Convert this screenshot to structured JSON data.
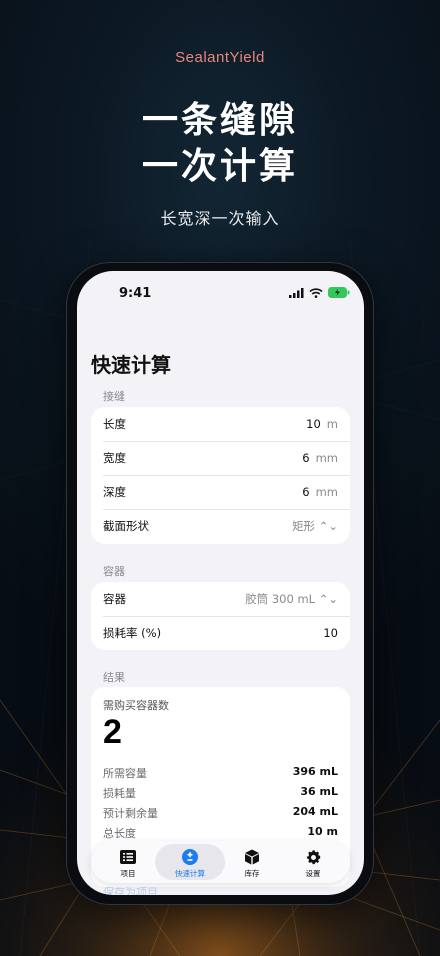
{
  "brand": "SealantYield",
  "headline_line1": "一条缝隙",
  "headline_line2": "一次计算",
  "tagline": "长宽深一次输入",
  "status_bar": {
    "time": "9:41"
  },
  "page_title": "快速计算",
  "joint": {
    "label": "接缝",
    "rows": [
      {
        "label": "长度",
        "value": "10",
        "unit": "m"
      },
      {
        "label": "宽度",
        "value": "6",
        "unit": "mm"
      },
      {
        "label": "深度",
        "value": "6",
        "unit": "mm"
      },
      {
        "label": "截面形状",
        "value": "矩形 ⌃⌄"
      }
    ]
  },
  "container": {
    "label": "容器",
    "rows": [
      {
        "label": "容器",
        "value": "胶筒 300 mL ⌃⌄"
      },
      {
        "label": "损耗率 (%)",
        "value": "10"
      }
    ]
  },
  "results": {
    "label": "结果",
    "title": "需购买容器数",
    "count": "2",
    "rows": [
      {
        "label": "所需容量",
        "value": "396 mL"
      },
      {
        "label": "损耗量",
        "value": "36 mL"
      },
      {
        "label": "预计剩余量",
        "value": "204 mL"
      },
      {
        "label": "总长度",
        "value": "10 m"
      }
    ]
  },
  "below_text": "保存为项目",
  "tabs": [
    {
      "label": "项目",
      "icon": "list-icon"
    },
    {
      "label": "快速计算",
      "icon": "plus-minus-icon",
      "active": true
    },
    {
      "label": "库存",
      "icon": "box-icon"
    },
    {
      "label": "设置",
      "icon": "gear-icon"
    }
  ],
  "colors": {
    "accent": "#1c7cf2",
    "brand": "#e8877b",
    "battery": "#34c759"
  }
}
